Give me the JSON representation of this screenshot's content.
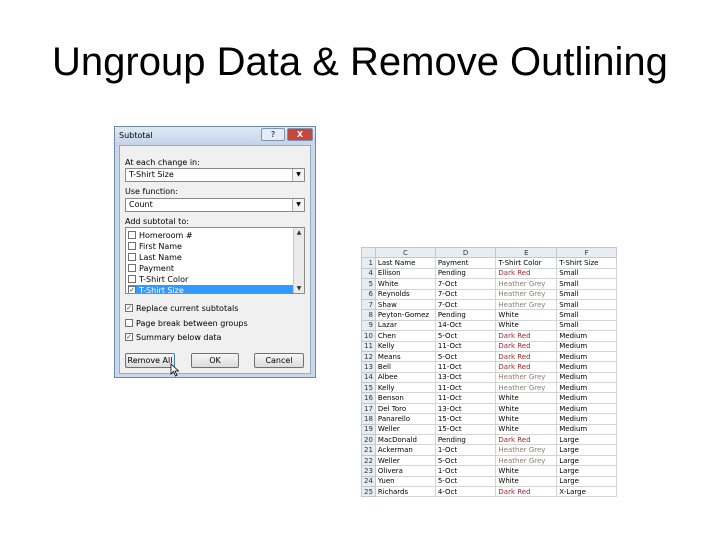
{
  "slide": {
    "title": "Ungroup Data & Remove Outlining"
  },
  "dialog": {
    "title": "Subtotal",
    "help_label": "?",
    "close_label": "X",
    "at_each_change_label": "At each change in:",
    "at_each_change_value": "T-Shirt Size",
    "use_function_label": "Use function:",
    "use_function_value": "Count",
    "add_subtotal_label": "Add subtotal to:",
    "subtotal_items": [
      {
        "label": "Homeroom #",
        "checked": false,
        "selected": false
      },
      {
        "label": "First Name",
        "checked": false,
        "selected": false
      },
      {
        "label": "Last Name",
        "checked": false,
        "selected": false
      },
      {
        "label": "Payment",
        "checked": false,
        "selected": false
      },
      {
        "label": "T-Shirt Color",
        "checked": false,
        "selected": false
      },
      {
        "label": "T-Shirt Size",
        "checked": true,
        "selected": true
      }
    ],
    "options": [
      {
        "label": "Replace current subtotals",
        "checked": true
      },
      {
        "label": "Page break between groups",
        "checked": false
      },
      {
        "label": "Summary below data",
        "checked": true
      }
    ],
    "buttons": {
      "remove_all": "Remove All",
      "ok": "OK",
      "cancel": "Cancel"
    }
  },
  "sheet": {
    "columns": [
      "C",
      "D",
      "E",
      "F"
    ],
    "header": {
      "row": "1",
      "cells": [
        "Last Name",
        "Payment",
        "T-Shirt Color",
        "T-Shirt Size"
      ]
    },
    "colors": {
      "red": "#a4262c",
      "grey": "#8a7f72"
    },
    "rows": [
      {
        "row": "4",
        "cells": [
          "Ellison",
          "Pending",
          "Dark Red",
          "Small"
        ],
        "tone": "red"
      },
      {
        "row": "5",
        "cells": [
          "White",
          "7-Oct",
          "Heather Grey",
          "Small"
        ],
        "tone": "grey"
      },
      {
        "row": "6",
        "cells": [
          "Reynolds",
          "7-Oct",
          "Heather Grey",
          "Small"
        ],
        "tone": "grey"
      },
      {
        "row": "7",
        "cells": [
          "Shaw",
          "7-Oct",
          "Heather Grey",
          "Small"
        ],
        "tone": "grey"
      },
      {
        "row": "8",
        "cells": [
          "Peyton-Gomez",
          "Pending",
          "White",
          "Small"
        ],
        "tone": "none"
      },
      {
        "row": "9",
        "cells": [
          "Lazar",
          "14-Oct",
          "White",
          "Small"
        ],
        "tone": "none"
      },
      {
        "row": "10",
        "cells": [
          "Chen",
          "5-Oct",
          "Dark Red",
          "Medium"
        ],
        "tone": "red"
      },
      {
        "row": "11",
        "cells": [
          "Kelly",
          "11-Oct",
          "Dark Red",
          "Medium"
        ],
        "tone": "red"
      },
      {
        "row": "12",
        "cells": [
          "Means",
          "5-Oct",
          "Dark Red",
          "Medium"
        ],
        "tone": "red"
      },
      {
        "row": "13",
        "cells": [
          "Bell",
          "11-Oct",
          "Dark Red",
          "Medium"
        ],
        "tone": "red"
      },
      {
        "row": "14",
        "cells": [
          "Albee",
          "13-Oct",
          "Heather Grey",
          "Medium"
        ],
        "tone": "grey"
      },
      {
        "row": "15",
        "cells": [
          "Kelly",
          "11-Oct",
          "Heather Grey",
          "Medium"
        ],
        "tone": "grey"
      },
      {
        "row": "16",
        "cells": [
          "Benson",
          "11-Oct",
          "White",
          "Medium"
        ],
        "tone": "none"
      },
      {
        "row": "17",
        "cells": [
          "Del Toro",
          "13-Oct",
          "White",
          "Medium"
        ],
        "tone": "none"
      },
      {
        "row": "18",
        "cells": [
          "Panarello",
          "15-Oct",
          "White",
          "Medium"
        ],
        "tone": "none"
      },
      {
        "row": "19",
        "cells": [
          "Weller",
          "15-Oct",
          "White",
          "Medium"
        ],
        "tone": "none"
      },
      {
        "row": "20",
        "cells": [
          "MacDonald",
          "Pending",
          "Dark Red",
          "Large"
        ],
        "tone": "red"
      },
      {
        "row": "21",
        "cells": [
          "Ackerman",
          "1-Oct",
          "Heather Grey",
          "Large"
        ],
        "tone": "grey"
      },
      {
        "row": "22",
        "cells": [
          "Weller",
          "5-Oct",
          "Heather Grey",
          "Large"
        ],
        "tone": "grey"
      },
      {
        "row": "23",
        "cells": [
          "Olivera",
          "1-Oct",
          "White",
          "Large"
        ],
        "tone": "none"
      },
      {
        "row": "24",
        "cells": [
          "Yuen",
          "5-Oct",
          "White",
          "Large"
        ],
        "tone": "none"
      },
      {
        "row": "25",
        "cells": [
          "Richards",
          "4-Oct",
          "Dark Red",
          "X-Large"
        ],
        "tone": "red"
      }
    ]
  }
}
